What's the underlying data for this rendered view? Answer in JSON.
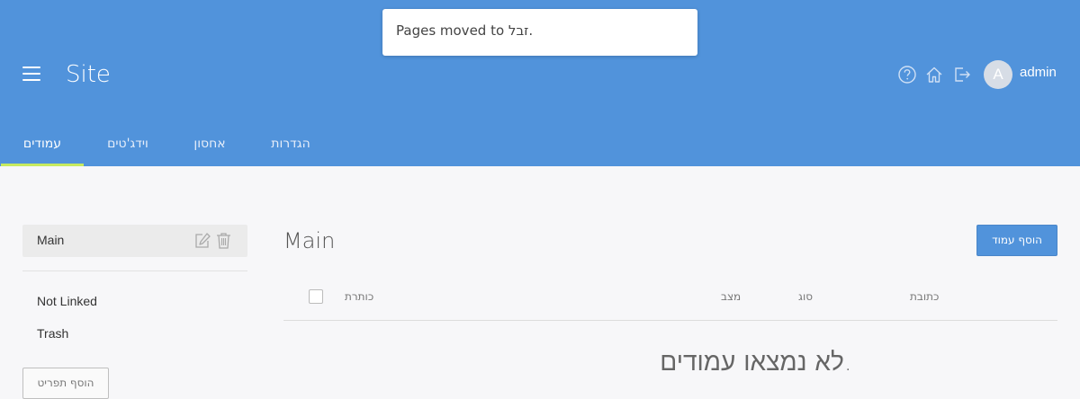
{
  "header": {
    "site_title": "Site",
    "username": "admin",
    "avatar_letter": "A",
    "icons": [
      "menu-icon",
      "help-icon",
      "home-icon",
      "logout-icon"
    ]
  },
  "tabs": [
    {
      "label": "עמודים",
      "active": true
    },
    {
      "label": "וידג'טים",
      "active": false
    },
    {
      "label": "אחסון",
      "active": false
    },
    {
      "label": "הגדרות",
      "active": false
    }
  ],
  "toast": {
    "message": "Pages moved to זבל."
  },
  "sidebar": {
    "main_label": "Main",
    "links": [
      "Not Linked",
      "Trash"
    ],
    "add_menu_label": "הוסף תפריט"
  },
  "main": {
    "title": "Main",
    "add_page_label": "הוסף עמוד",
    "columns": {
      "title": "כותרת",
      "status": "מצב",
      "type": "סוג",
      "url": "כתובת"
    },
    "empty_message": "לא נמצאו עמודים."
  },
  "colors": {
    "accent": "#5193db",
    "tab_underline": "#c6ea60",
    "background": "#f7f7f9"
  }
}
